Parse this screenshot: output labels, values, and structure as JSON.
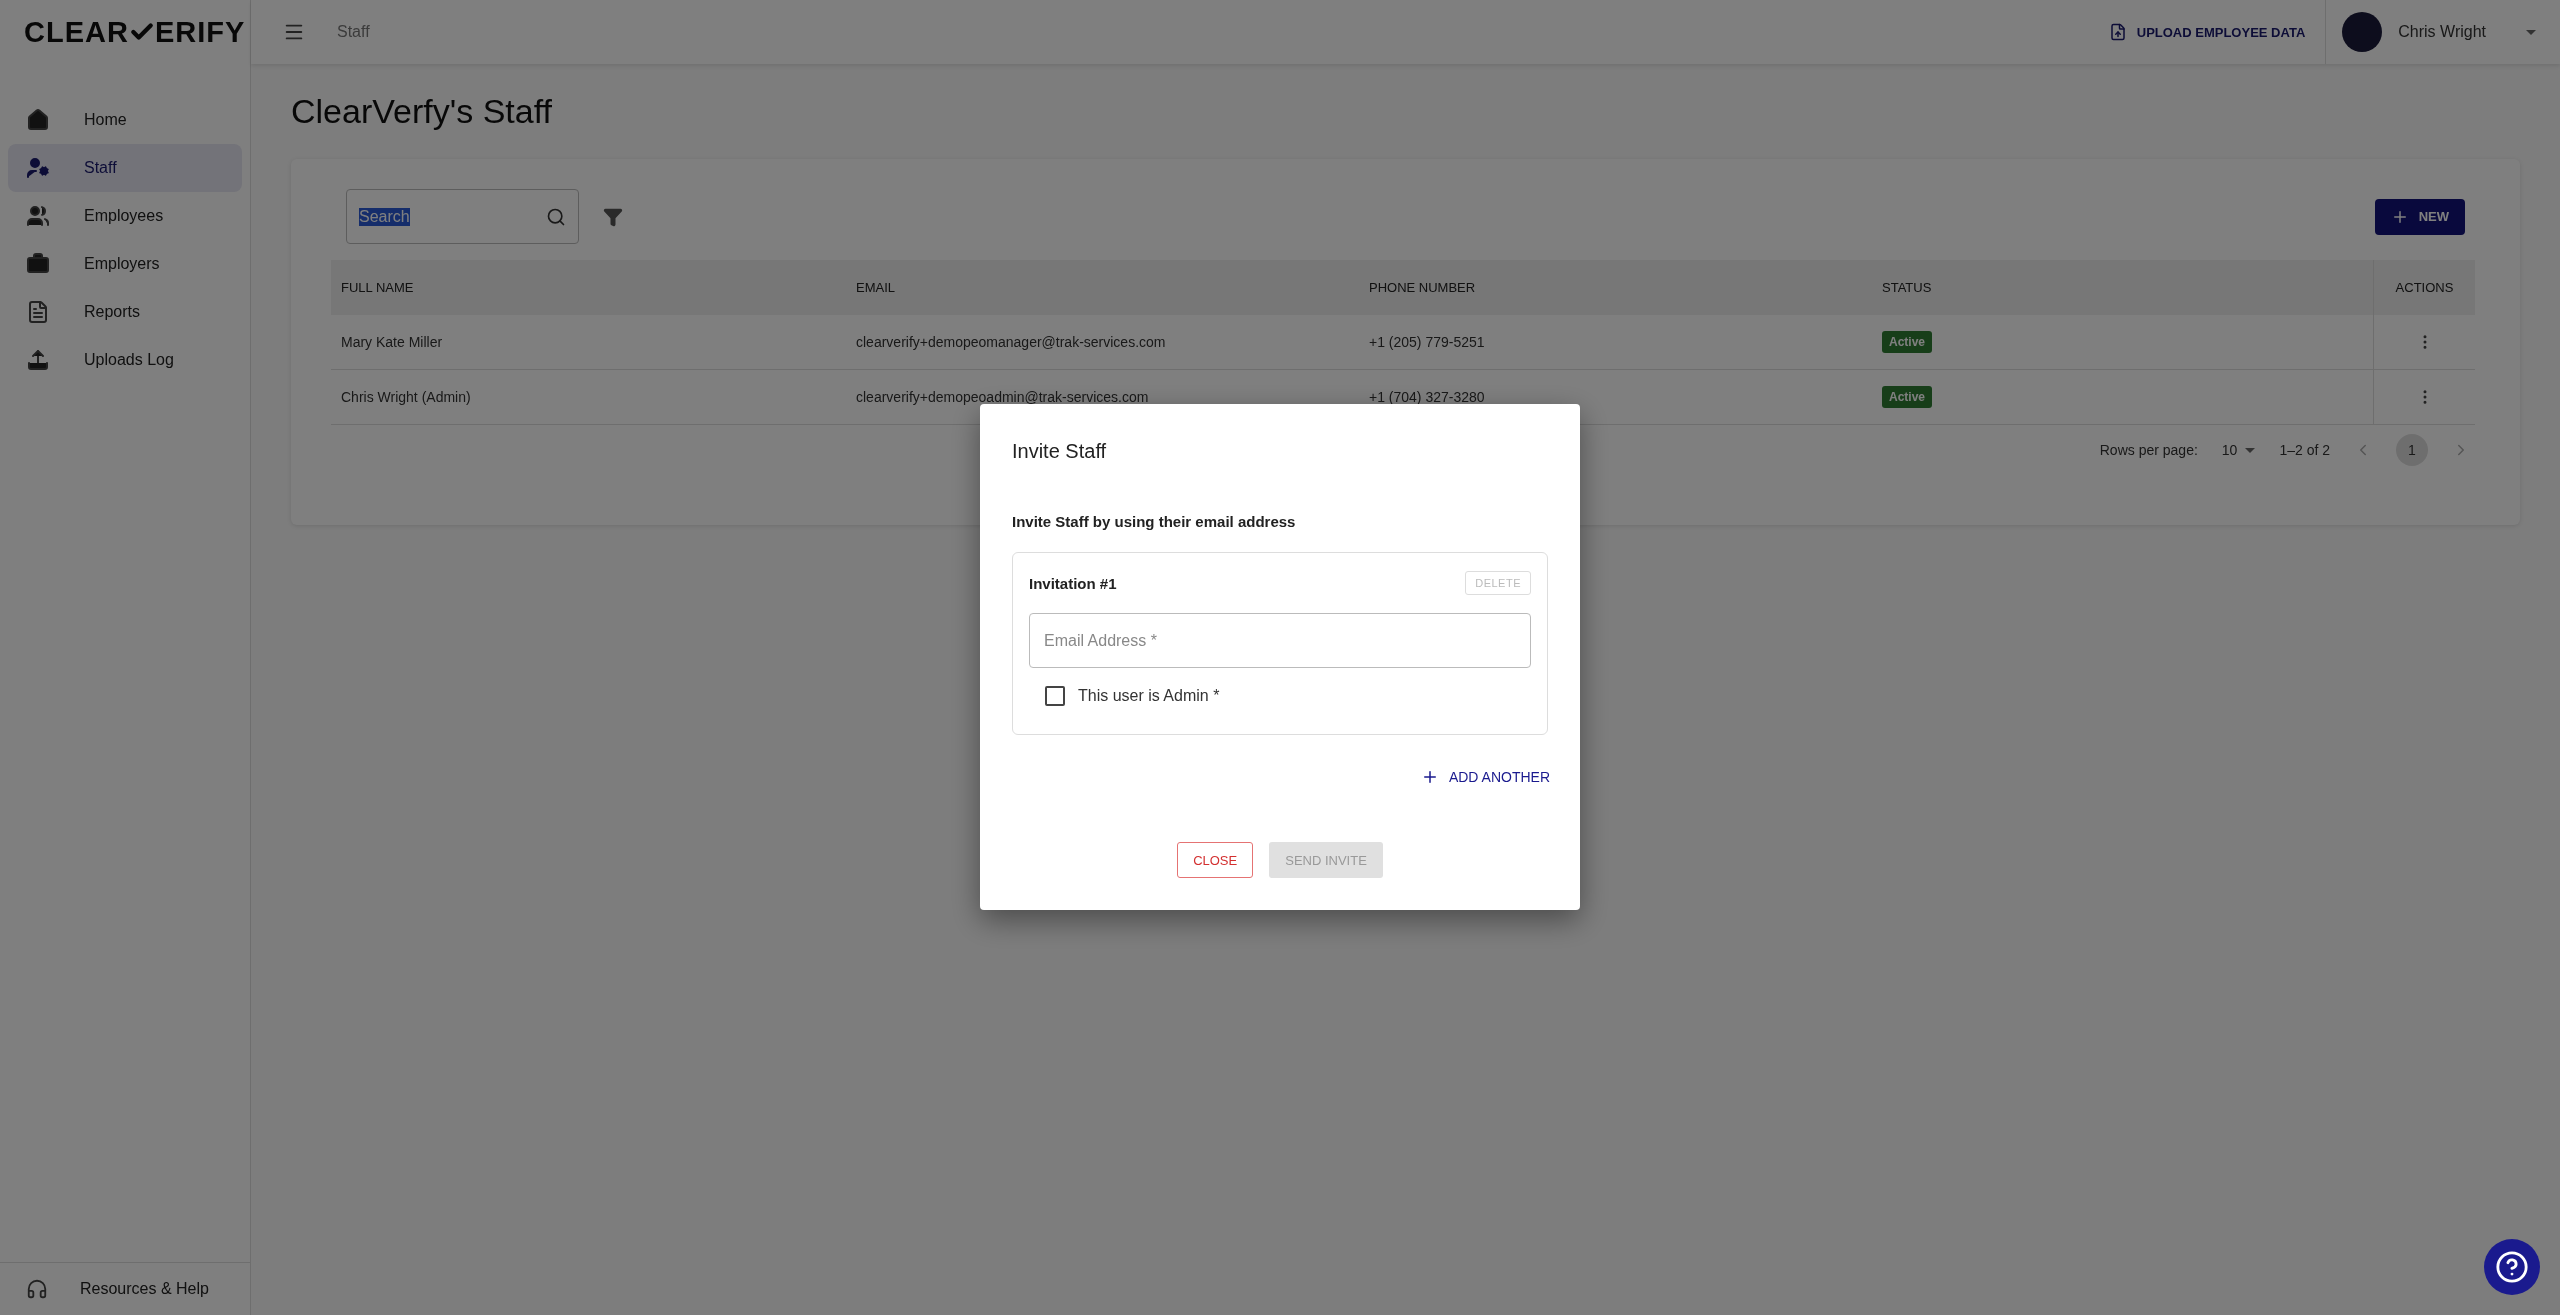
{
  "logo": {
    "before": "CLEAR",
    "after": "ERIFY"
  },
  "topbar": {
    "breadcrumb": "Staff",
    "upload_button": "UPLOAD EMPLOYEE DATA",
    "user_name": "Chris Wright"
  },
  "sidebar": {
    "items": [
      {
        "label": "Home",
        "kind": "home",
        "selected": false
      },
      {
        "label": "Staff",
        "kind": "staff",
        "selected": true
      },
      {
        "label": "Employees",
        "kind": "people",
        "selected": false
      },
      {
        "label": "Employers",
        "kind": "briefcase",
        "selected": false
      },
      {
        "label": "Reports",
        "kind": "report",
        "selected": false
      },
      {
        "label": "Uploads Log",
        "kind": "upload",
        "selected": false
      }
    ],
    "footer": "Resources & Help"
  },
  "page_title": "ClearVerfy's Staff",
  "toolbar": {
    "search": {
      "value": "Search",
      "text_selected": true
    },
    "new_button": "NEW"
  },
  "table": {
    "columns": [
      "FULL NAME",
      "EMAIL",
      "PHONE NUMBER",
      "STATUS",
      "ACTIONS"
    ],
    "rows": [
      {
        "name": "Mary Kate Miller",
        "email": "clearverify+demopeomanager@trak-services.com",
        "phone": "+1 (205) 779-5251",
        "status": "Active"
      },
      {
        "name": "Chris Wright (Admin)",
        "email": "clearverify+demopeoadmin@trak-services.com",
        "phone": "+1 (704) 327-3280",
        "status": "Active"
      }
    ],
    "pagination": {
      "rows_per_page_label": "Rows per page:",
      "rows_per_page": "10",
      "range": "1–2 of 2",
      "page": "1"
    }
  },
  "dialog": {
    "title": "Invite Staff",
    "subtitle": "Invite Staff by using their email address",
    "invitations": [
      {
        "heading": "Invitation #1",
        "delete_button": "DELETE",
        "delete_disabled": true,
        "email_placeholder": "Email Address *",
        "admin_label": "This user is Admin *",
        "admin_checked": false
      }
    ],
    "add_another": "ADD ANOTHER",
    "close_button": "CLOSE",
    "send_button": "SEND INVITE",
    "send_disabled": true
  }
}
